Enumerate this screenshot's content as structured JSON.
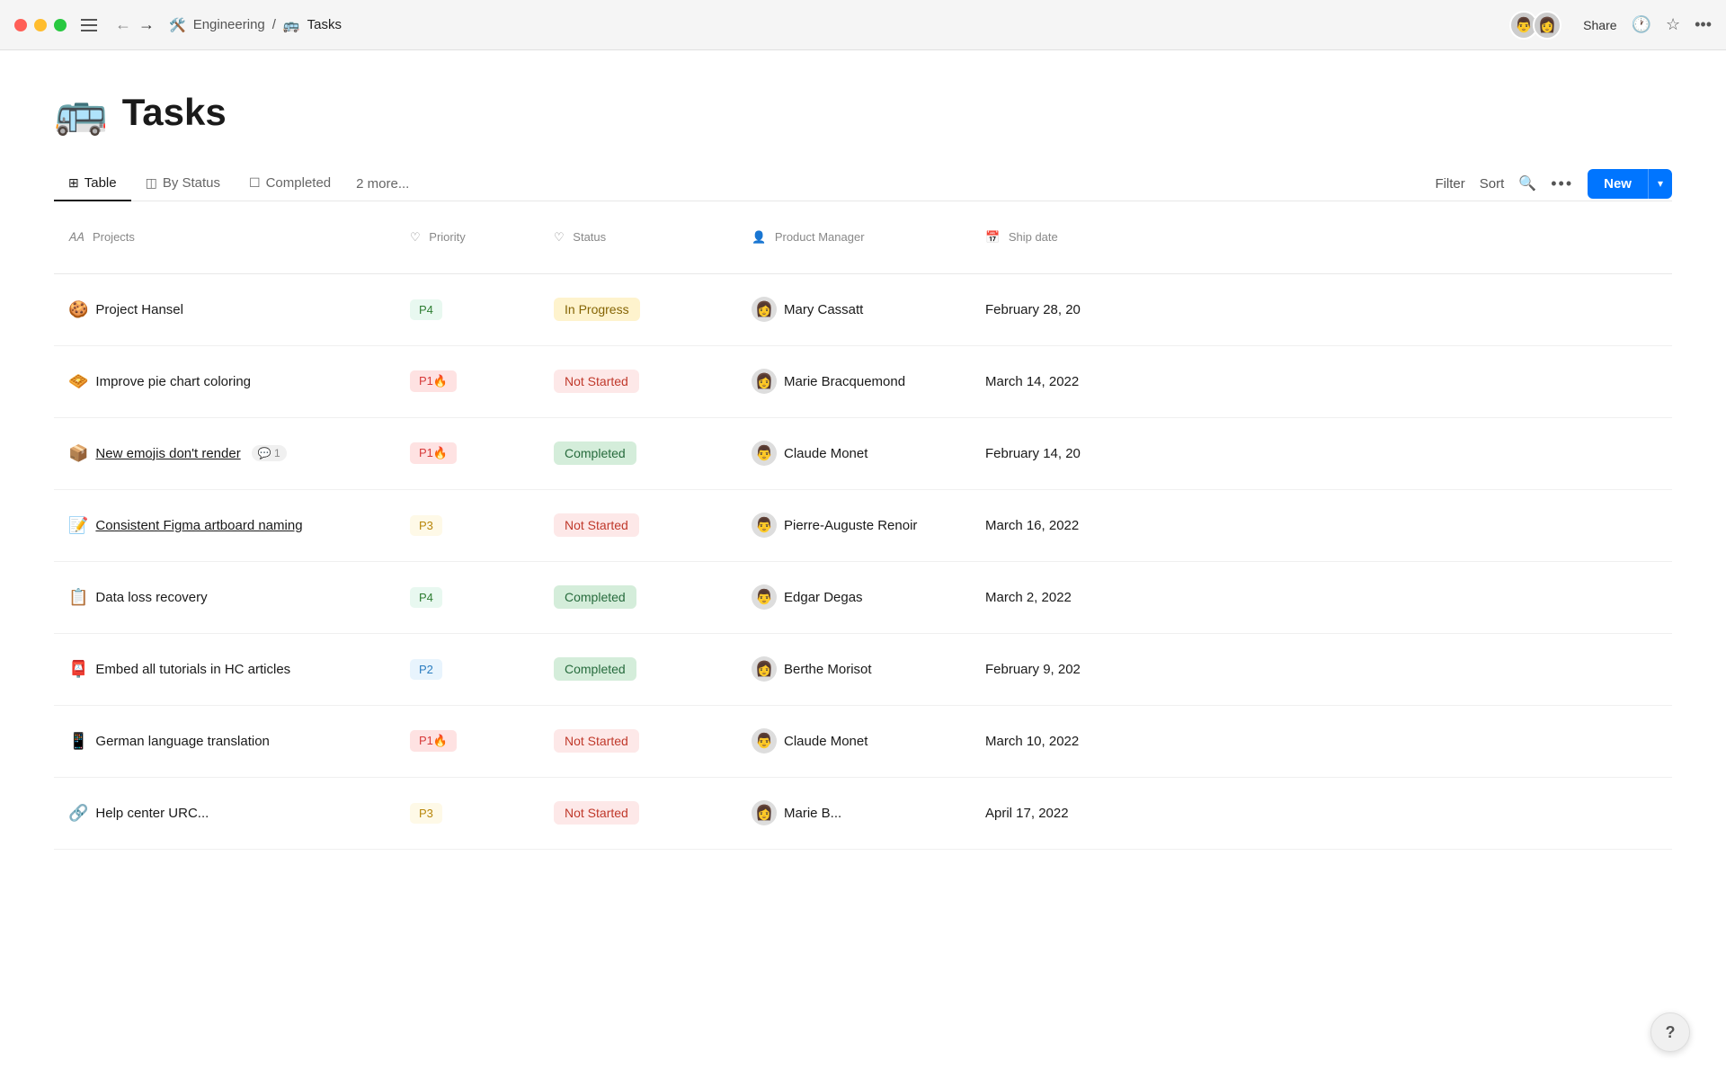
{
  "titlebar": {
    "back_arrow": "←",
    "forward_arrow": "→",
    "breadcrumb": {
      "workspace_emoji": "🛠️",
      "workspace": "Engineering",
      "separator": "/",
      "page_emoji": "🚌",
      "page": "Tasks"
    },
    "share_label": "Share",
    "more_label": "•••"
  },
  "page": {
    "title_emoji": "🚌",
    "title": "Tasks"
  },
  "tabs": [
    {
      "id": "table",
      "icon": "⊞",
      "label": "Table",
      "active": true
    },
    {
      "id": "by-status",
      "icon": "◎",
      "label": "By Status",
      "active": false
    },
    {
      "id": "completed",
      "icon": "☐",
      "label": "Completed",
      "active": false
    }
  ],
  "more_tabs_label": "2 more...",
  "toolbar": {
    "filter_label": "Filter",
    "sort_label": "Sort",
    "new_label": "New"
  },
  "table": {
    "columns": [
      {
        "id": "projects",
        "icon": "𝔸𝔸",
        "label": "Projects"
      },
      {
        "id": "priority",
        "icon": "♡",
        "label": "Priority"
      },
      {
        "id": "status",
        "icon": "♡",
        "label": "Status"
      },
      {
        "id": "pm",
        "icon": "👤",
        "label": "Product Manager"
      },
      {
        "id": "ship",
        "icon": "📅",
        "label": "Ship date"
      }
    ],
    "rows": [
      {
        "emoji": "🍪",
        "name": "Project Hansel",
        "underline": false,
        "comments": null,
        "priority": "P4",
        "priority_class": "priority-p4",
        "status": "In Progress",
        "status_class": "status-in-progress",
        "pm_emoji": "👩",
        "pm": "Mary Cassatt",
        "ship_date": "February 28, 20"
      },
      {
        "emoji": "🧇",
        "name": "Improve pie chart coloring",
        "underline": false,
        "comments": null,
        "priority": "P1🔥",
        "priority_class": "priority-p1",
        "status": "Not Started",
        "status_class": "status-not-started",
        "pm_emoji": "👩",
        "pm": "Marie Bracquemond",
        "ship_date": "March 14, 2022"
      },
      {
        "emoji": "📦",
        "name": "New emojis don't render",
        "underline": true,
        "comments": 1,
        "priority": "P1🔥",
        "priority_class": "priority-p1",
        "status": "Completed",
        "status_class": "status-completed",
        "pm_emoji": "👨",
        "pm": "Claude Monet",
        "ship_date": "February 14, 20"
      },
      {
        "emoji": "📝",
        "name": "Consistent Figma artboard naming",
        "underline": true,
        "comments": null,
        "priority": "P3",
        "priority_class": "priority-p3",
        "status": "Not Started",
        "status_class": "status-not-started",
        "pm_emoji": "👨",
        "pm": "Pierre-Auguste Renoir",
        "ship_date": "March 16, 2022"
      },
      {
        "emoji": "📋",
        "name": "Data loss recovery",
        "underline": false,
        "comments": null,
        "priority": "P4",
        "priority_class": "priority-p4",
        "status": "Completed",
        "status_class": "status-completed",
        "pm_emoji": "👨",
        "pm": "Edgar Degas",
        "ship_date": "March 2, 2022"
      },
      {
        "emoji": "📮",
        "name": "Embed all tutorials in HC articles",
        "underline": false,
        "comments": null,
        "priority": "P2",
        "priority_class": "priority-p2",
        "status": "Completed",
        "status_class": "status-completed",
        "pm_emoji": "👩",
        "pm": "Berthe Morisot",
        "ship_date": "February 9, 202"
      },
      {
        "emoji": "📱",
        "name": "German language translation",
        "underline": false,
        "comments": null,
        "priority": "P1🔥",
        "priority_class": "priority-p1",
        "status": "Not Started",
        "status_class": "status-not-started",
        "pm_emoji": "👨",
        "pm": "Claude Monet",
        "ship_date": "March 10, 2022"
      },
      {
        "emoji": "🔗",
        "name": "Help center URC...",
        "underline": false,
        "comments": null,
        "priority": "P3",
        "priority_class": "priority-p3",
        "status": "Not Started",
        "status_class": "status-not-started",
        "pm_emoji": "👩",
        "pm": "Marie B...",
        "ship_date": "April 17, 2022"
      }
    ]
  },
  "help_label": "?"
}
